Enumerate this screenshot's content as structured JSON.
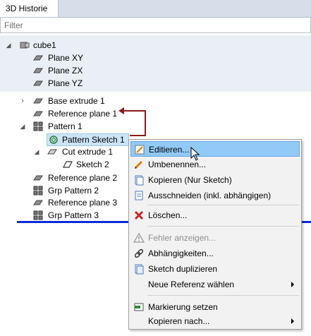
{
  "tab": {
    "label": "3D Historie"
  },
  "filter": {
    "placeholder": "Filter"
  },
  "tree": {
    "group_name": "cube1",
    "items": [
      {
        "label": "Plane XY"
      },
      {
        "label": "Plane ZX"
      },
      {
        "label": "Plane YZ"
      },
      {
        "label": "Base extrude 1"
      },
      {
        "label": "Reference plane 1"
      },
      {
        "label": "Pattern 1"
      },
      {
        "label": "Pattern Sketch 1"
      },
      {
        "label": "Cut extrude 1"
      },
      {
        "label": "Sketch 2"
      },
      {
        "label": "Reference plane 2"
      },
      {
        "label": "Grp Pattern 2"
      },
      {
        "label": "Reference plane 3"
      },
      {
        "label": "Grp Pattern 3"
      }
    ]
  },
  "context_menu": {
    "items": [
      {
        "label": "Editieren...",
        "icon": "pencil-icon",
        "highlighted": true
      },
      {
        "label": "Umbenennen...",
        "icon": "rename-pencil-icon"
      },
      {
        "label": "Kopieren (Nur Sketch)",
        "icon": "copy-page-icon"
      },
      {
        "label": "Ausschneiden (inkl. abhängigen)",
        "icon": "cut-page-icon"
      },
      {
        "label": "Löschen...",
        "icon": "delete-x-icon"
      },
      {
        "label": "Fehler anzeigen...",
        "icon": "warning-icon",
        "disabled": true
      },
      {
        "label": "Abhängigkeiten...",
        "icon": "link-icon"
      },
      {
        "label": "Sketch duplizieren",
        "icon": "duplicate-page-icon"
      },
      {
        "label": "Neue Referenz wählen",
        "icon": "",
        "submenu": true
      },
      {
        "label": "Markierung setzen",
        "icon": "marker-flag-icon"
      },
      {
        "label": "Kopieren nach...",
        "icon": "",
        "submenu": true
      }
    ]
  },
  "colors": {
    "accent": "#0b2bd8",
    "reference_arrow": "#8b1a1a",
    "menu_highlight": "#91c9f7"
  }
}
